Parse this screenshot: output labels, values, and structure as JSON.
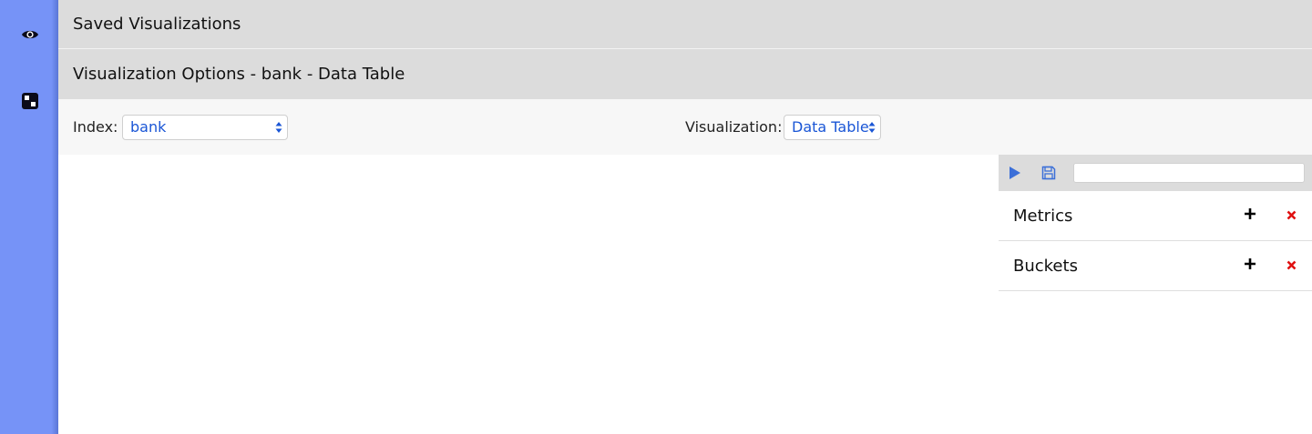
{
  "sidebar": {
    "icons": [
      {
        "name": "eye-icon"
      },
      {
        "name": "dashboard-icon"
      }
    ]
  },
  "header": {
    "saved_title": "Saved Visualizations",
    "options_title": "Visualization Options - bank - Data Table"
  },
  "options": {
    "index_label": "Index:",
    "index_value": "bank",
    "visualization_label": "Visualization:",
    "visualization_value": "Data Table"
  },
  "panel": {
    "toolbar": {
      "run_icon": "play-icon",
      "save_icon": "floppy-disk-icon",
      "search_value": ""
    },
    "sections": [
      {
        "title": "Metrics",
        "add_icon": "plus-icon",
        "remove_icon": "close-icon"
      },
      {
        "title": "Buckets",
        "add_icon": "plus-icon",
        "remove_icon": "close-icon"
      }
    ]
  },
  "colors": {
    "sidebar": "#7693f7",
    "header_bar": "#dcdcdc",
    "options_row": "#f7f7f7",
    "select_text": "#1a56d6",
    "run_icon": "#3b6fd8",
    "remove_icon": "#e01010"
  }
}
